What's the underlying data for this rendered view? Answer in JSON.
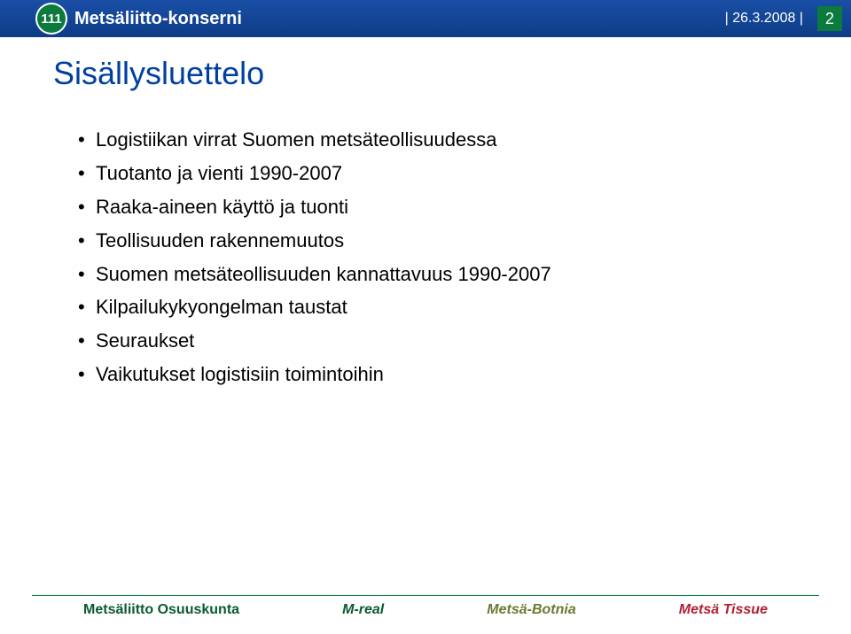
{
  "header": {
    "logo_number": "111",
    "logo_text": "Metsäliitto-konserni",
    "date": "| 26.3.2008 |",
    "page_number": "2"
  },
  "title": "Sisällysluettelo",
  "bullets": [
    "Logistiikan virrat Suomen metsäteollisuudessa",
    "Tuotanto ja vienti 1990-2007",
    "Raaka-aineen käyttö ja tuonti",
    "Teollisuuden rakennemuutos",
    "Suomen metsäteollisuuden kannattavuus 1990-2007",
    "Kilpailukykyongelman taustat",
    "Seuraukset",
    "Vaikutukset logistisiin toimintoihin"
  ],
  "footer": {
    "brands": [
      "Metsäliitto Osuuskunta",
      "M-real",
      "Metsä-Botnia",
      "Metsä Tissue"
    ]
  }
}
